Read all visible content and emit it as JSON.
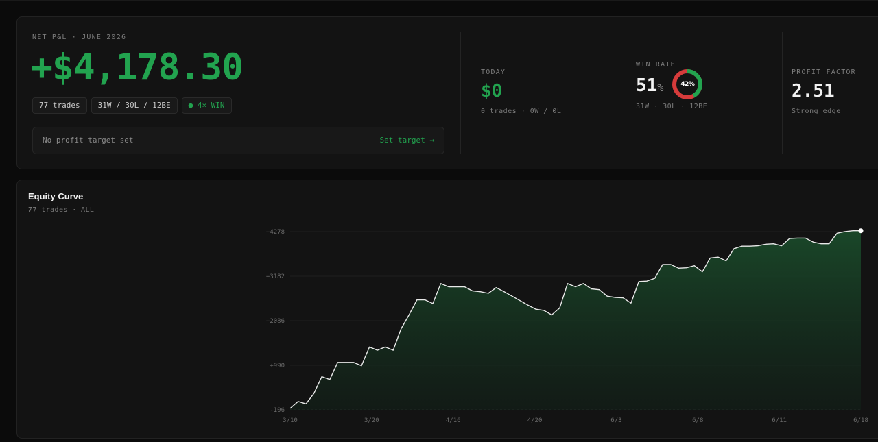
{
  "summary": {
    "label": "NET P&L · JUNE 2026",
    "value": "+$4,178.30",
    "chips": {
      "trades": "77 trades",
      "record": "31W / 30L / 12BE",
      "streak": "● 4× WIN"
    },
    "target": {
      "text": "No profit target set",
      "link": "Set target →"
    }
  },
  "today": {
    "label": "TODAY",
    "value": "$0",
    "sub": "0 trades · 0W / 0L"
  },
  "win_rate": {
    "label": "WIN RATE",
    "value": "51",
    "unit": "%",
    "donut_label": "42%",
    "donut_fraction": 0.42,
    "sub": "31W · 30L · 12BE"
  },
  "profit_factor": {
    "label": "PROFIT FACTOR",
    "value": "2.51",
    "sub": "Strong edge"
  },
  "colors": {
    "accent_green": "#22a34f",
    "loss_red": "#d63b3b",
    "line_white": "#e8e8e8"
  },
  "chart": {
    "title": "Equity Curve",
    "sub": "77 trades · ALL"
  },
  "chart_data": {
    "type": "area",
    "title": "Equity Curve",
    "yticks": [
      -106,
      990,
      2086,
      3182,
      4278
    ],
    "ytick_labels": [
      "-106",
      "+990",
      "+2086",
      "+3182",
      "+4278"
    ],
    "ylim": [
      -106,
      4278
    ],
    "xtick_labels": [
      "3/10",
      "3/20",
      "4/16",
      "4/20",
      "6/3",
      "6/8",
      "6/11",
      "6/18"
    ],
    "xlim": [
      0,
      72
    ],
    "x": [
      0,
      1,
      2,
      3,
      4,
      5,
      6,
      7,
      8,
      9,
      10,
      11,
      12,
      13,
      14,
      15,
      16,
      17,
      18,
      19,
      20,
      21,
      22,
      23,
      24,
      25,
      26,
      27,
      28,
      29,
      30,
      31,
      32,
      33,
      34,
      35,
      36,
      37,
      38,
      39,
      40,
      41,
      42,
      43,
      44,
      45,
      46,
      47,
      48,
      49,
      50,
      51,
      52,
      53,
      54,
      55,
      56,
      57,
      58,
      59,
      60,
      61,
      62,
      63,
      64,
      65,
      66,
      67,
      68,
      69,
      70,
      71,
      72
    ],
    "y": [
      -70,
      100,
      40,
      300,
      710,
      640,
      1060,
      1060,
      1060,
      980,
      1440,
      1360,
      1440,
      1360,
      1890,
      2230,
      2600,
      2600,
      2510,
      3000,
      2920,
      2920,
      2920,
      2820,
      2800,
      2760,
      2900,
      2800,
      2690,
      2580,
      2470,
      2370,
      2340,
      2230,
      2400,
      3000,
      2920,
      3000,
      2870,
      2850,
      2690,
      2660,
      2650,
      2520,
      3050,
      3060,
      3130,
      3470,
      3470,
      3380,
      3390,
      3440,
      3290,
      3630,
      3650,
      3560,
      3860,
      3920,
      3920,
      3930,
      3970,
      3980,
      3930,
      4110,
      4120,
      4120,
      4020,
      3980,
      3980,
      4240,
      4280,
      4300,
      4300
    ]
  }
}
